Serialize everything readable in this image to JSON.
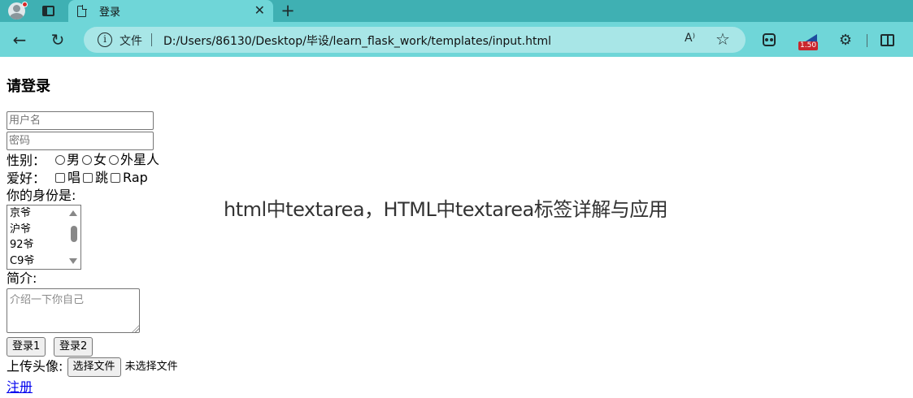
{
  "browser": {
    "tab": {
      "title": "登录"
    },
    "address_bar": {
      "file_label": "文件",
      "url": "D:/Users/86130/Desktop/毕设/learn_flask_work/templates/input.html"
    },
    "read_aloud_label": "A⁾",
    "extension_badge": "1.50"
  },
  "page": {
    "heading": "请登录",
    "username_placeholder": "用户名",
    "password_placeholder": "密码",
    "gender": {
      "label": "性别：",
      "options": [
        "男",
        "女",
        "外星人"
      ]
    },
    "hobby": {
      "label": "爱好：",
      "options": [
        "唱",
        "跳",
        "Rap"
      ]
    },
    "identity": {
      "label": "你的身份是:",
      "options": [
        "京爷",
        "沪爷",
        "92爷",
        "C9爷"
      ]
    },
    "intro": {
      "label": "简介:",
      "placeholder": "介绍一下你自己"
    },
    "buttons": {
      "login1": "登录1",
      "login2": "登录2"
    },
    "upload": {
      "label": "上传头像:",
      "choose_button": "选择文件",
      "no_file": "未选择文件"
    },
    "register_link": "注册"
  },
  "overlay_caption": "html中textarea，HTML中textarea标签详解与应用",
  "colors": {
    "tabbar": "#3fb0b3",
    "toolbar": "#6fd6d8",
    "address_bar": "#a8e6e7",
    "link": "#0000ee"
  }
}
